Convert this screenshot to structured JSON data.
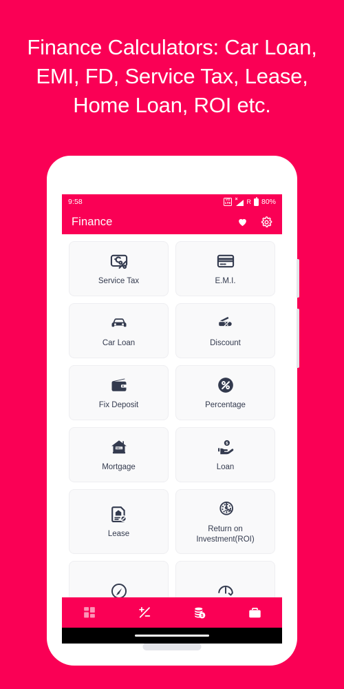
{
  "promo": {
    "lines": [
      "Finance Calculators: Car Loan,",
      "EMI, FD, Service Tax, Lease,",
      "Home Loan, ROI etc."
    ]
  },
  "colors": {
    "brand_pink": "#fa0055",
    "icon_navy": "#333a4e",
    "card_bg": "#f9f9fa",
    "card_border": "#eeeef1",
    "screen_bg": "#ffffff",
    "gesture_bar": "#000000",
    "hardware_grey": "#e4e5ea"
  },
  "status_bar": {
    "time": "9:58",
    "volte_label": "VO LTE",
    "volte_top": "VO",
    "volte_bottom": "LTE",
    "signal_icon": "signal-bars-icon",
    "signal_x": "×",
    "roaming": "R",
    "battery_icon": "battery-icon",
    "battery_percent": "80%"
  },
  "app_bar": {
    "title": "Finance",
    "favorite_icon": "heart-icon",
    "settings_icon": "gear-icon"
  },
  "grid": {
    "items": [
      {
        "label": "Service Tax",
        "icon": "receipt-percent-icon"
      },
      {
        "label": "E.M.I.",
        "icon": "credit-card-icon"
      },
      {
        "label": "Car Loan",
        "icon": "car-icon"
      },
      {
        "label": "Discount",
        "icon": "discount-tag-icon"
      },
      {
        "label": "Fix Deposit",
        "icon": "wallet-icon"
      },
      {
        "label": "Percentage",
        "icon": "percent-circle-icon"
      },
      {
        "label": "Mortgage",
        "icon": "house-sell-icon"
      },
      {
        "label": "Loan",
        "icon": "hand-coin-icon"
      },
      {
        "label": "Lease",
        "icon": "document-house-pencil-icon"
      },
      {
        "label": "Return on Investment(ROI)",
        "icon": "dollar-pie-chart-icon"
      },
      {
        "label": "",
        "icon": "speedometer-icon"
      },
      {
        "label": "",
        "icon": "gauge-clock-icon"
      }
    ]
  },
  "bottom_nav": {
    "items": [
      {
        "icon": "grid-dashboard-icon",
        "active": false
      },
      {
        "icon": "plus-minus-icon",
        "active": true
      },
      {
        "icon": "coins-dollar-icon",
        "active": true
      },
      {
        "icon": "briefcase-icon",
        "active": true
      }
    ]
  },
  "phone_hardware": {
    "earpiece": "earpiece-speaker",
    "camera": "front-camera-dot",
    "sensor": "proximity-sensor-dot",
    "power_button": "power-button",
    "volume_button": "volume-button",
    "bottom_speaker": "bottom-speaker-grille",
    "home_indicator": "home-indicator"
  }
}
